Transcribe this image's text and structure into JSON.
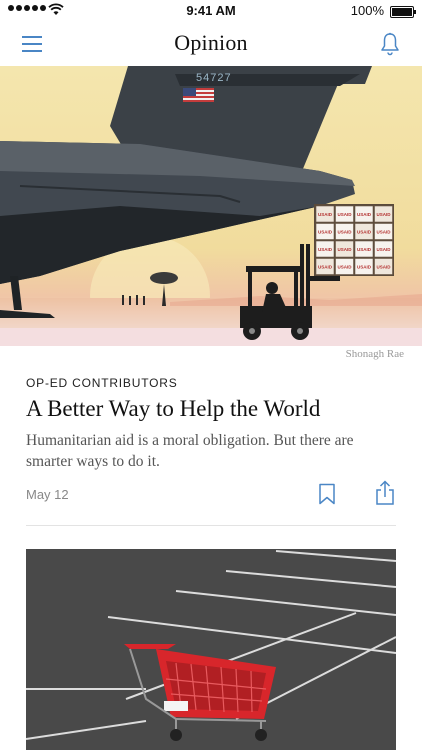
{
  "status_bar": {
    "time": "9:41 AM",
    "battery_percent": "100%",
    "battery_level": 1.0,
    "signal_bars": 5
  },
  "nav": {
    "title": "Opinion",
    "menu_icon": "hamburger-menu-icon",
    "bell_icon": "bell-icon"
  },
  "article": {
    "image_text": {
      "tail_number": "54727",
      "crate_label": "USAID"
    },
    "photo_credit": "Shonagh Rae",
    "kicker": "OP-ED CONTRIBUTORS",
    "headline": "A Better Way to Help the World",
    "summary": "Humanitarian aid is a moral obligation. But there are smarter ways to do it.",
    "date": "May 12",
    "bookmark_icon": "bookmark-icon",
    "share_icon": "share-icon"
  },
  "colors": {
    "accent": "#4a86c5",
    "sky": "#f2dfa0",
    "cart_red": "#d8262b"
  }
}
